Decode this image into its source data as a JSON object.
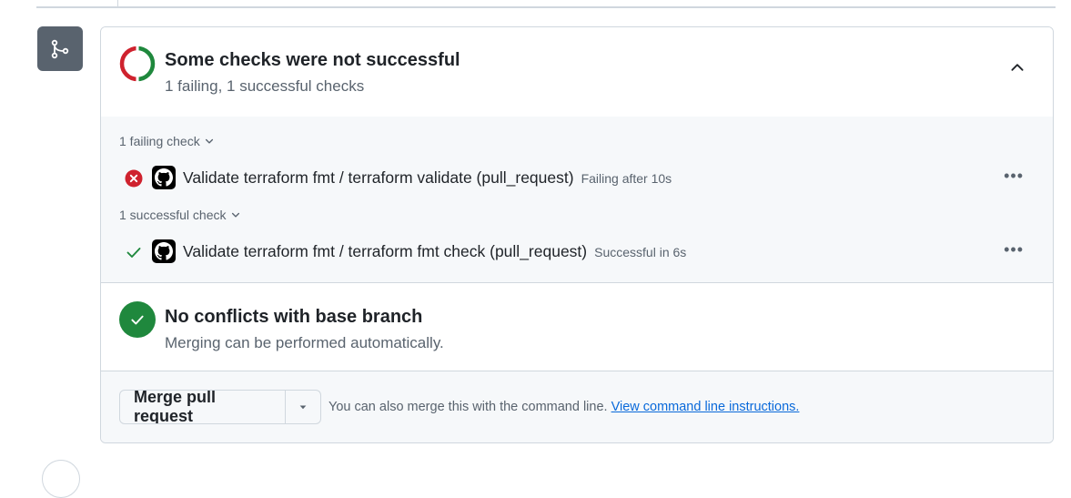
{
  "colors": {
    "fail": "#cf222e",
    "success": "#1f883d",
    "link": "#0969da",
    "muted": "#59636e",
    "border": "#d0d7de"
  },
  "timeline": {
    "icon": "git-merge-icon"
  },
  "checks_summary": {
    "icon": "status-ring-icon",
    "title": "Some checks were not successful",
    "subtitle": "1 failing, 1 successful checks",
    "collapse_icon": "chevron-up-icon"
  },
  "failing_group": {
    "label": "1 failing check",
    "items": [
      {
        "status_icon": "x-circle-fill-icon",
        "app_icon": "github-icon",
        "name": "Validate terraform fmt / terraform validate (pull_request)",
        "status": "Failing after 10s",
        "menu_icon": "kebab-horizontal-icon"
      }
    ]
  },
  "successful_group": {
    "label": "1 successful check",
    "items": [
      {
        "status_icon": "check-icon",
        "app_icon": "github-icon",
        "name": "Validate terraform fmt / terraform fmt check (pull_request)",
        "status": "Successful in 6s",
        "menu_icon": "kebab-horizontal-icon"
      }
    ]
  },
  "conflicts": {
    "icon": "check-circle-icon",
    "title": "No conflicts with base branch",
    "subtitle": "Merging can be performed automatically."
  },
  "merge": {
    "button_label": "Merge pull request",
    "caret_icon": "triangle-down-icon",
    "hint_text": "You can also merge this with the command line.",
    "hint_link": "View command line instructions."
  }
}
